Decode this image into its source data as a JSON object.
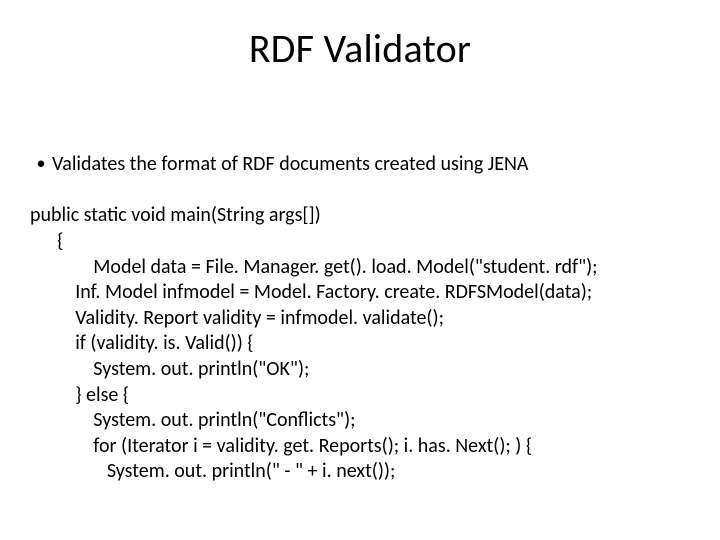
{
  "title": "RDF Validator",
  "bullet": {
    "text": "Validates the format of RDF documents created using JENA"
  },
  "code": {
    "l1": "public static void main(String args[])",
    "l2": "      {",
    "l3": "              Model data = File. Manager. get(). load. Model(\"student. rdf\");",
    "l4": "          Inf. Model infmodel = Model. Factory. create. RDFSModel(data);",
    "l5": "          Validity. Report validity = infmodel. validate();",
    "l6": "          if (validity. is. Valid()) {",
    "l7": "              System. out. println(\"OK\");",
    "l8": "          } else {",
    "l9": "              System. out. println(\"Conflicts\");",
    "l10": "              for (Iterator i = validity. get. Reports(); i. has. Next(); ) {",
    "l11": "                 System. out. println(\" - \" + i. next());"
  }
}
